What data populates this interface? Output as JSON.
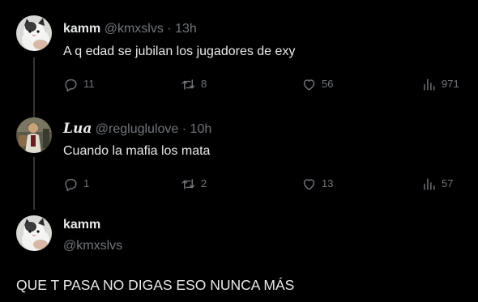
{
  "theme": {
    "background": "#000000",
    "text_primary": "#e7e9ea",
    "text_secondary": "#71767b"
  },
  "tweets": [
    {
      "display_name": "kamm",
      "handle": "@kmxslvs",
      "separator": "·",
      "time": "13h",
      "text": "A q edad se jubilan los jugadores de exy",
      "replies": "11",
      "retweets": "8",
      "likes": "56",
      "views": "971",
      "avatar_icon": "cat-avatar-icon"
    },
    {
      "display_name": "Lua",
      "handle": "@regluglulove",
      "separator": "·",
      "time": "10h",
      "text": "Cuando la mafia los mata",
      "replies": "1",
      "retweets": "2",
      "likes": "13",
      "views": "57",
      "avatar_icon": "person-avatar-icon"
    }
  ],
  "main_tweet": {
    "display_name": "kamm",
    "handle": "@kmxslvs",
    "text": "QUE T PASA NO DIGAS ESO NUNCA MÁS",
    "avatar_icon": "cat-avatar-icon"
  }
}
